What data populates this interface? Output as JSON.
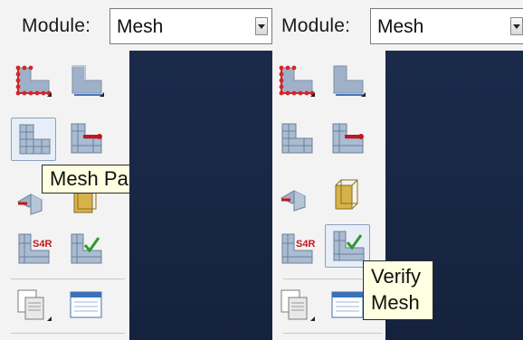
{
  "left_panel": {
    "module_label": "Module:",
    "module_value": "Mesh",
    "tooltip": "Mesh Part"
  },
  "right_panel": {
    "module_label": "Module:",
    "module_value": "Mesh",
    "tooltip_line1": "Verify",
    "tooltip_line2": "Mesh"
  },
  "icon_labels": {
    "element_type": "S4R"
  },
  "colors": {
    "viewport": "#1b2a4a",
    "tooltip_bg": "#ffffe1",
    "toolbox_bg": "#f3f3f3"
  }
}
